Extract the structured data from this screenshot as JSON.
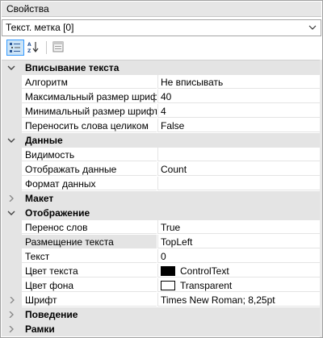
{
  "panel": {
    "title": "Свойства"
  },
  "object_selector": {
    "value": "Текст. метка [0]"
  },
  "toolbar": {
    "buttons": [
      {
        "icon": "categorized-icon",
        "active": true
      },
      {
        "icon": "sort-alphabetical-icon",
        "active": false
      },
      {
        "icon": "property-pages-icon",
        "active": false
      }
    ]
  },
  "categories": [
    {
      "label": "Вписывание текста",
      "expanded": true,
      "properties": [
        {
          "name": "Алгоритм",
          "value": "Не вписывать"
        },
        {
          "name": "Максимальный размер шрифта",
          "value": "40"
        },
        {
          "name": "Минимальный размер шрифта",
          "value": "4"
        },
        {
          "name": "Переносить слова целиком",
          "value": "False"
        }
      ]
    },
    {
      "label": "Данные",
      "expanded": true,
      "properties": [
        {
          "name": "Видимость",
          "value": ""
        },
        {
          "name": "Отображать данные",
          "value": "Count"
        },
        {
          "name": "Формат данных",
          "value": ""
        }
      ]
    },
    {
      "label": "Макет",
      "expanded": false,
      "properties": []
    },
    {
      "label": "Отображение",
      "expanded": true,
      "properties": [
        {
          "name": "Перенос слов",
          "value": "True"
        },
        {
          "name": "Размещение текста",
          "value": "TopLeft",
          "selected": true
        },
        {
          "name": "Текст",
          "value": "0"
        },
        {
          "name": "Цвет текста",
          "value": "ControlText",
          "swatch": "#000000"
        },
        {
          "name": "Цвет фона",
          "value": "Transparent",
          "swatch": "#ffffff"
        },
        {
          "name": "Шрифт",
          "value": "Times New Roman; 8,25pt",
          "expandable": true
        }
      ]
    },
    {
      "label": "Поведение",
      "expanded": false,
      "properties": []
    },
    {
      "label": "Рамки",
      "expanded": false,
      "properties": []
    }
  ]
}
